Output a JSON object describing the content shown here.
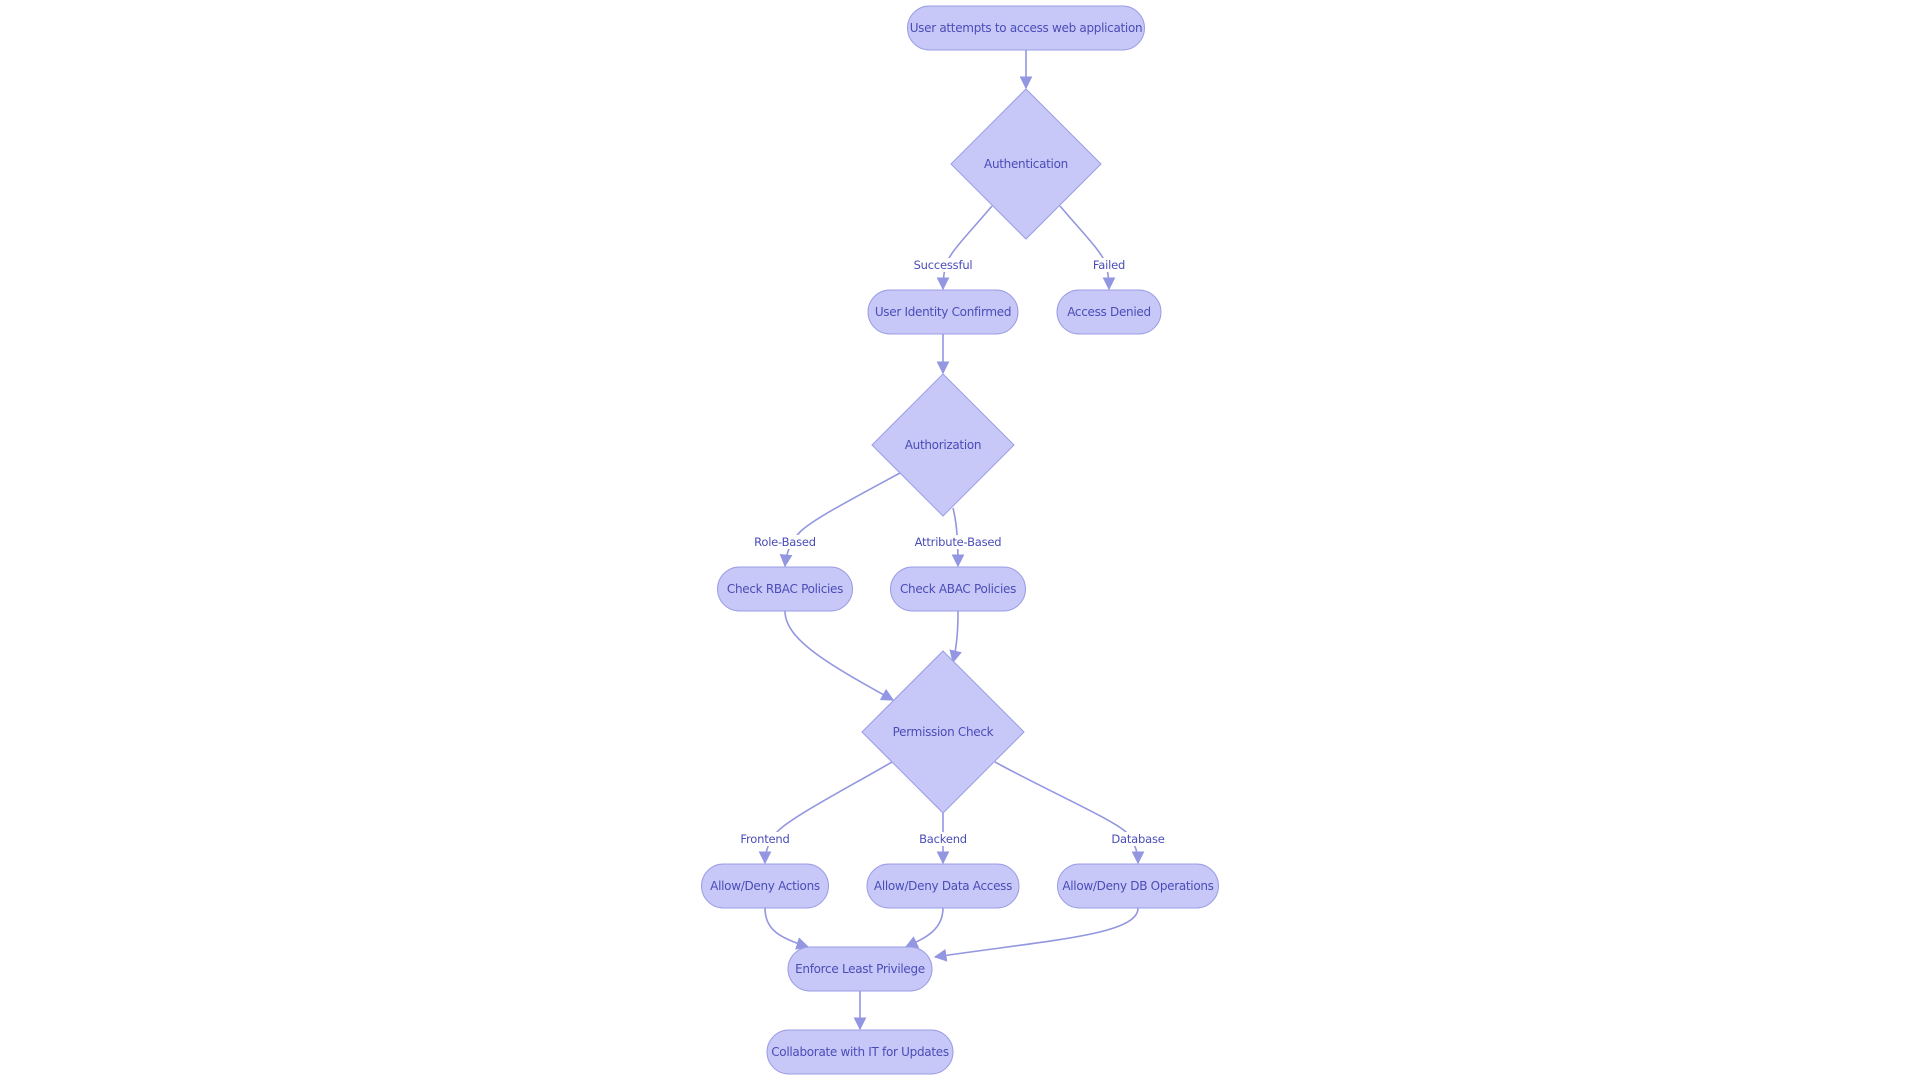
{
  "diagram": {
    "type": "flowchart",
    "colors": {
      "node_fill": "#c7c8f8",
      "node_stroke": "#9a9ce4",
      "edge": "#9396e0",
      "text": "#4a4cb8",
      "background": "#ffffff"
    },
    "nodes": [
      {
        "id": "start",
        "shape": "rounded",
        "label": "User attempts to access web application"
      },
      {
        "id": "authn",
        "shape": "diamond",
        "label": "Authentication"
      },
      {
        "id": "confirmed",
        "shape": "rounded",
        "label": "User Identity Confirmed"
      },
      {
        "id": "denied",
        "shape": "rounded",
        "label": "Access Denied"
      },
      {
        "id": "authz",
        "shape": "diamond",
        "label": "Authorization"
      },
      {
        "id": "rbac",
        "shape": "rounded",
        "label": "Check RBAC Policies"
      },
      {
        "id": "abac",
        "shape": "rounded",
        "label": "Check ABAC Policies"
      },
      {
        "id": "perm",
        "shape": "diamond",
        "label": "Permission Check"
      },
      {
        "id": "actions",
        "shape": "rounded",
        "label": "Allow/Deny Actions"
      },
      {
        "id": "data",
        "shape": "rounded",
        "label": "Allow/Deny Data Access"
      },
      {
        "id": "db",
        "shape": "rounded",
        "label": "Allow/Deny DB Operations"
      },
      {
        "id": "least",
        "shape": "rounded",
        "label": "Enforce Least Privilege"
      },
      {
        "id": "collab",
        "shape": "rounded",
        "label": "Collaborate with IT for Updates"
      }
    ],
    "edges": [
      {
        "from": "start",
        "to": "authn",
        "label": ""
      },
      {
        "from": "authn",
        "to": "confirmed",
        "label": "Successful"
      },
      {
        "from": "authn",
        "to": "denied",
        "label": "Failed"
      },
      {
        "from": "confirmed",
        "to": "authz",
        "label": ""
      },
      {
        "from": "authz",
        "to": "rbac",
        "label": "Role-Based"
      },
      {
        "from": "authz",
        "to": "abac",
        "label": "Attribute-Based"
      },
      {
        "from": "rbac",
        "to": "perm",
        "label": ""
      },
      {
        "from": "abac",
        "to": "perm",
        "label": ""
      },
      {
        "from": "perm",
        "to": "actions",
        "label": "Frontend"
      },
      {
        "from": "perm",
        "to": "data",
        "label": "Backend"
      },
      {
        "from": "perm",
        "to": "db",
        "label": "Database"
      },
      {
        "from": "actions",
        "to": "least",
        "label": ""
      },
      {
        "from": "data",
        "to": "least",
        "label": ""
      },
      {
        "from": "db",
        "to": "least",
        "label": ""
      },
      {
        "from": "least",
        "to": "collab",
        "label": ""
      }
    ]
  }
}
